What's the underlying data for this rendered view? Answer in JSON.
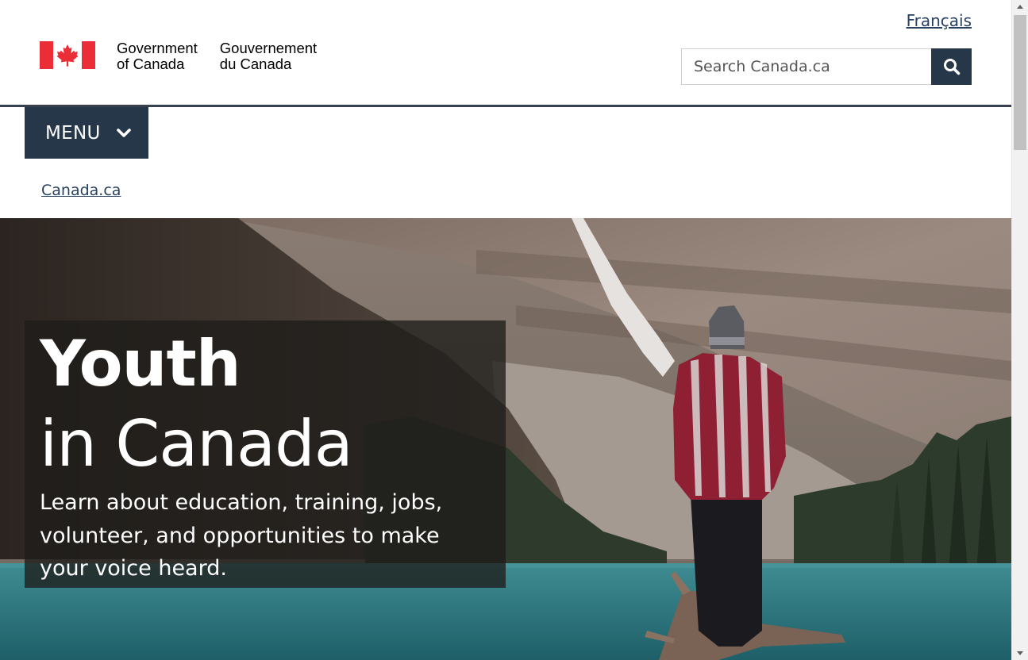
{
  "header": {
    "language_link": "Français",
    "wordmark_en": "Government\nof Canada",
    "wordmark_fr": "Gouvernement\ndu Canada",
    "search": {
      "placeholder": "Search Canada.ca"
    },
    "flag_colors": {
      "red": "#eb2d37",
      "white": "#ffffff"
    }
  },
  "menu": {
    "label": "MENU"
  },
  "breadcrumb": {
    "items": [
      "Canada.ca"
    ]
  },
  "hero": {
    "title_line1": "Youth",
    "title_line2": "in Canada",
    "lead": "Learn about education, training, jobs, volunteer, and opportunities to make your voice heard."
  },
  "theme": {
    "accent": "#26374a",
    "link": "#284162"
  },
  "icons": {
    "search": "search-icon",
    "menu_chevron": "chevron-down-icon",
    "flag": "maple-leaf-flag-icon"
  }
}
